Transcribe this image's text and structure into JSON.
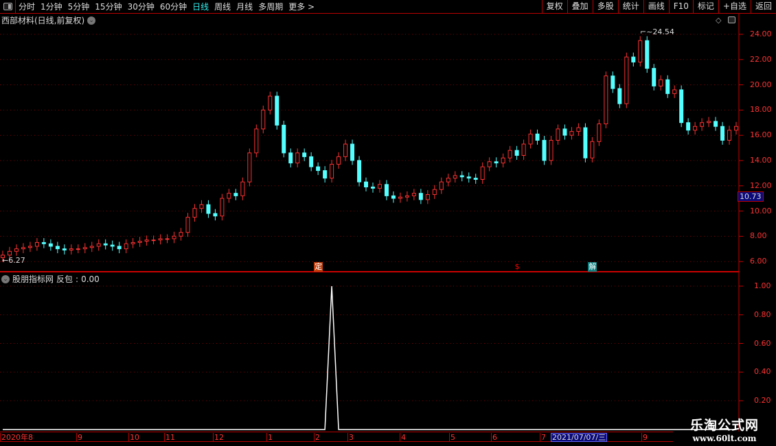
{
  "toolbar": {
    "periods": [
      "分时",
      "1分钟",
      "5分钟",
      "15分钟",
      "30分钟",
      "60分钟",
      "日线",
      "周线",
      "月线",
      "多周期",
      "更多 >"
    ],
    "active_period": "日线",
    "buttons": [
      "复权",
      "叠加",
      "多股",
      "统计",
      "画线",
      "F10",
      "标记",
      "+自选",
      "返回"
    ]
  },
  "main": {
    "title": "西部材料(日线,前复权)",
    "high_label": "24.54",
    "low_label": "6.27",
    "current_price": "10.73",
    "y_ticks": [
      "24.00",
      "22.00",
      "20.00",
      "18.00",
      "16.00",
      "14.00",
      "12.00",
      "10.00",
      "8.00",
      "6.00"
    ],
    "signals": [
      {
        "text": "定",
        "index": 46,
        "color": "#c04010"
      },
      {
        "text": "$",
        "index": 75,
        "color": "#f00"
      },
      {
        "text": "解",
        "index": 86,
        "color": "#108080"
      }
    ]
  },
  "indicator": {
    "title": "股朋指标网",
    "name": "反包",
    "value": "0.00",
    "y_ticks": [
      "1.00",
      "0.80",
      "0.60",
      "0.40",
      "0.20"
    ]
  },
  "xaxis": {
    "months": [
      "2020年8",
      "9",
      "10",
      "11",
      "12",
      "1",
      "2",
      "3",
      "4",
      "5",
      "6",
      "7",
      "9"
    ],
    "cursor_date": "2021/07/07/三"
  },
  "watermark": {
    "title": "乐淘公式网",
    "url": "www.60lt.com"
  },
  "colors": {
    "up": "#ff3232",
    "down": "#54ffff",
    "axis": "#cc0000",
    "active": "#33eeee"
  },
  "chart_data": {
    "type": "candlestick",
    "y_range": [
      6.0,
      24.54
    ],
    "closes": [
      6.5,
      6.8,
      7.0,
      7.1,
      7.2,
      7.5,
      7.4,
      7.2,
      7.0,
      6.9,
      7.0,
      7.0,
      7.1,
      7.2,
      7.4,
      7.3,
      7.2,
      7.0,
      7.4,
      7.5,
      7.6,
      7.7,
      7.7,
      7.8,
      7.8,
      8.0,
      8.3,
      9.5,
      10.2,
      10.5,
      9.8,
      9.6,
      11.0,
      11.4,
      11.2,
      12.3,
      14.6,
      16.5,
      18.0,
      19.1,
      16.8,
      14.6,
      13.8,
      14.6,
      14.3,
      13.5,
      13.2,
      12.6,
      13.7,
      14.3,
      15.3,
      14.0,
      12.3,
      11.9,
      11.8,
      12.1,
      11.2,
      11.0,
      11.1,
      11.2,
      11.4,
      10.9,
      11.3,
      11.7,
      12.3,
      12.6,
      12.8,
      12.7,
      12.6,
      12.5,
      13.5,
      13.9,
      13.8,
      14.2,
      14.8,
      14.4,
      15.3,
      16.1,
      15.6,
      14.0,
      15.6,
      16.5,
      16.0,
      16.3,
      16.6,
      14.2,
      15.5,
      16.9,
      20.7,
      19.7,
      18.5,
      22.2,
      21.8,
      23.5,
      21.3,
      19.9,
      20.4,
      19.3,
      19.6,
      17.0,
      16.4,
      16.7,
      17.0,
      17.1,
      16.7,
      15.6,
      16.4,
      16.7
    ],
    "indicator_spike_index": 48,
    "indicator_spike_value": 1.0
  }
}
